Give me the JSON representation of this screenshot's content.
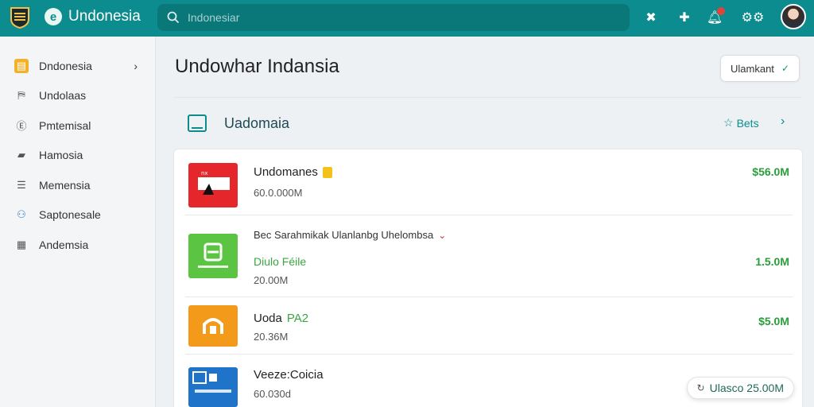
{
  "header": {
    "brand": "Undonesia",
    "search_placeholder": "Indonesiar"
  },
  "sidebar": {
    "items": [
      {
        "label": "Dndonesia",
        "icon": "document-icon",
        "active": true
      },
      {
        "label": "Undolaas",
        "icon": "map-icon"
      },
      {
        "label": "Pmtemisal",
        "icon": "coin-icon"
      },
      {
        "label": "Hamosia",
        "icon": "chart-icon"
      },
      {
        "label": "Memensia",
        "icon": "list-icon"
      },
      {
        "label": "Saptonesale",
        "icon": "people-icon"
      },
      {
        "label": "Andemsia",
        "icon": "table-icon"
      }
    ]
  },
  "main": {
    "title": "Undowhar Indansia",
    "dropdown": {
      "label": "Ulamkant"
    },
    "section": {
      "title": "Uadomaia",
      "link": "Bets"
    },
    "rows": [
      {
        "name": "Undomanes",
        "sub": "60.0.000M",
        "amount": "$56.0M"
      },
      {
        "heading": "Bec Sarahmikak Ulanlanbg Uhelombsa",
        "name": "Diulo Féile",
        "sub": "20.00M",
        "amount": "1.5.0M"
      },
      {
        "name": "Uoda",
        "name_accent": "PA2",
        "sub": "20.36M",
        "amount": "$5.0M"
      },
      {
        "name": "Veeze:Coicia",
        "sub": "60.030d",
        "pill": "Ulasco 25.00M"
      }
    ]
  },
  "colors": {
    "topbar": "#0c8c8e",
    "amount_green": "#2a9d3a",
    "accent_teal": "#0c8c8e"
  }
}
